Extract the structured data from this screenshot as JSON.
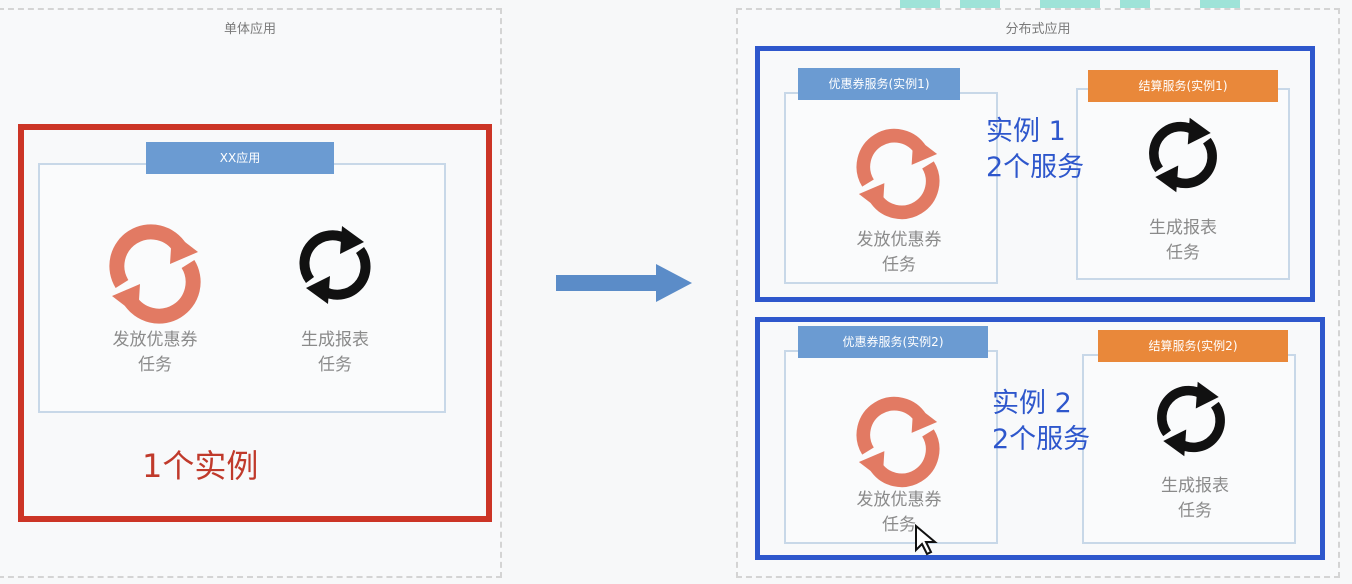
{
  "left": {
    "title": "单体应用",
    "app_tag": "XX应用",
    "task_coupon": [
      "发放优惠券",
      "任务"
    ],
    "task_report": [
      "生成报表",
      "任务"
    ],
    "note": "1个实例"
  },
  "right": {
    "title": "分布式应用",
    "instance1": {
      "coupon_tag": "优惠券服务(实例1)",
      "settle_tag": "结算服务(实例1)",
      "task_coupon": [
        "发放优惠券",
        "任务"
      ],
      "task_report": [
        "生成报表",
        "任务"
      ],
      "note": [
        "实例 1",
        "2个服务"
      ]
    },
    "instance2": {
      "coupon_tag": "优惠券服务(实例2)",
      "settle_tag": "结算服务(实例2)",
      "task_coupon": [
        "发放优惠券",
        "任务"
      ],
      "task_report": [
        "生成报表",
        "任务"
      ],
      "note": [
        "实例 2",
        "2个服务"
      ]
    }
  },
  "colors": {
    "coupon_icon": "#e27a63",
    "report_icon": "#111111",
    "red_highlight": "#cc3526",
    "blue_highlight": "#2e57cc",
    "arrow": "#5b8cc8"
  },
  "icons": {
    "coupon": "refresh-cycle-icon",
    "report": "sync-arrows-icon",
    "arrow": "right-arrow-icon",
    "cursor": "mouse-pointer-icon"
  }
}
